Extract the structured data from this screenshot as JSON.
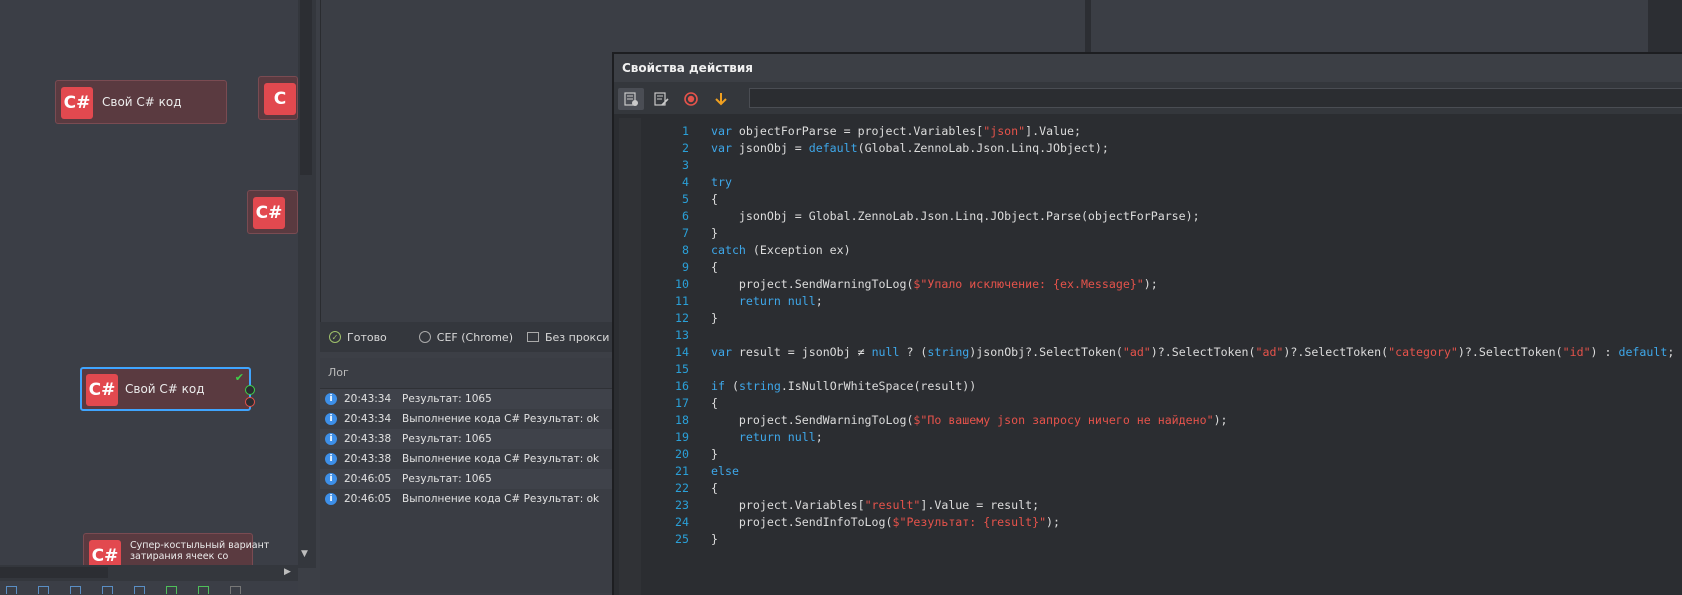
{
  "canvas": {
    "nodes": [
      {
        "badge": "C#",
        "label": "Свой C# код"
      },
      {
        "badge": "C#",
        "label": "Свой C# код"
      },
      {
        "badge": "C#",
        "label": "Супер-костыльный вариант затирания ячеек со"
      }
    ],
    "partial_badges": [
      "C",
      "C#"
    ]
  },
  "browser_status": {
    "ready": "Готово",
    "engine": "CEF (Chrome)",
    "proxy": "Без прокси"
  },
  "log": {
    "title": "Лог",
    "entries": [
      {
        "time": "20:43:34",
        "message": " Результат: 1065"
      },
      {
        "time": "20:43:34",
        "message": "Выполнение кода C#  Результат: ok"
      },
      {
        "time": "20:43:38",
        "message": " Результат: 1065"
      },
      {
        "time": "20:43:38",
        "message": "Выполнение кода C#  Результат: ok"
      },
      {
        "time": "20:46:05",
        "message": " Результат: 1065"
      },
      {
        "time": "20:46:05",
        "message": "Выполнение кода C#  Результат: ok"
      }
    ]
  },
  "dialog": {
    "title": "Свойства действия",
    "toolbar_icons": [
      "properties-icon",
      "edit-icon",
      "record-icon",
      "download-arrow-icon"
    ],
    "code_lines": [
      [
        {
          "t": "kw",
          "v": "var"
        },
        {
          "t": "tx",
          "v": " objectForParse = project.Variables["
        },
        {
          "t": "str",
          "v": "\"json\""
        },
        {
          "t": "tx",
          "v": "].Value;"
        }
      ],
      [
        {
          "t": "kw",
          "v": "var"
        },
        {
          "t": "tx",
          "v": " jsonObj = "
        },
        {
          "t": "kw",
          "v": "default"
        },
        {
          "t": "tx",
          "v": "(Global.ZennoLab.Json.Linq.JObject);"
        }
      ],
      [],
      [
        {
          "t": "kw",
          "v": "try"
        }
      ],
      [
        {
          "t": "tx",
          "v": "{"
        }
      ],
      [
        {
          "t": "tx",
          "v": "    jsonObj = Global.ZennoLab.Json.Linq.JObject.Parse(objectForParse);"
        }
      ],
      [
        {
          "t": "tx",
          "v": "}"
        }
      ],
      [
        {
          "t": "kw",
          "v": "catch"
        },
        {
          "t": "tx",
          "v": " (Exception ex)"
        }
      ],
      [
        {
          "t": "tx",
          "v": "{"
        }
      ],
      [
        {
          "t": "tx",
          "v": "    project.SendWarningToLog("
        },
        {
          "t": "str",
          "v": "$\"Упало исключение: {ex.Message}\""
        },
        {
          "t": "tx",
          "v": ");"
        }
      ],
      [
        {
          "t": "tx",
          "v": "    "
        },
        {
          "t": "kw",
          "v": "return"
        },
        {
          "t": "tx",
          "v": " "
        },
        {
          "t": "kw",
          "v": "null"
        },
        {
          "t": "tx",
          "v": ";"
        }
      ],
      [
        {
          "t": "tx",
          "v": "}"
        }
      ],
      [],
      [
        {
          "t": "kw",
          "v": "var"
        },
        {
          "t": "tx",
          "v": " result = jsonObj ≠ "
        },
        {
          "t": "kw",
          "v": "null"
        },
        {
          "t": "tx",
          "v": " ? ("
        },
        {
          "t": "kw",
          "v": "string"
        },
        {
          "t": "tx",
          "v": ")jsonObj?.SelectToken("
        },
        {
          "t": "str",
          "v": "\"ad\""
        },
        {
          "t": "tx",
          "v": ")?.SelectToken("
        },
        {
          "t": "str",
          "v": "\"ad\""
        },
        {
          "t": "tx",
          "v": ")?.SelectToken("
        },
        {
          "t": "str",
          "v": "\"category\""
        },
        {
          "t": "tx",
          "v": ")?.SelectToken("
        },
        {
          "t": "str",
          "v": "\"id\""
        },
        {
          "t": "tx",
          "v": ") : "
        },
        {
          "t": "kw",
          "v": "default"
        },
        {
          "t": "tx",
          "v": ";"
        }
      ],
      [],
      [
        {
          "t": "kw",
          "v": "if"
        },
        {
          "t": "tx",
          "v": " ("
        },
        {
          "t": "kw",
          "v": "string"
        },
        {
          "t": "tx",
          "v": ".IsNullOrWhiteSpace(result))"
        }
      ],
      [
        {
          "t": "tx",
          "v": "{"
        }
      ],
      [
        {
          "t": "tx",
          "v": "    project.SendWarningToLog("
        },
        {
          "t": "str",
          "v": "$\"По вашему json запросу ничего не найдено\""
        },
        {
          "t": "tx",
          "v": ");"
        }
      ],
      [
        {
          "t": "tx",
          "v": "    "
        },
        {
          "t": "kw",
          "v": "return"
        },
        {
          "t": "tx",
          "v": " "
        },
        {
          "t": "kw",
          "v": "null"
        },
        {
          "t": "tx",
          "v": ";"
        }
      ],
      [
        {
          "t": "tx",
          "v": "}"
        }
      ],
      [
        {
          "t": "kw",
          "v": "else"
        }
      ],
      [
        {
          "t": "tx",
          "v": "{"
        }
      ],
      [
        {
          "t": "tx",
          "v": "    project.Variables["
        },
        {
          "t": "str",
          "v": "\"result\""
        },
        {
          "t": "tx",
          "v": "].Value = result;"
        }
      ],
      [
        {
          "t": "tx",
          "v": "    project.SendInfoToLog("
        },
        {
          "t": "str",
          "v": "$\"Результат: {result}\""
        },
        {
          "t": "tx",
          "v": ");"
        }
      ],
      [
        {
          "t": "tx",
          "v": "}"
        }
      ]
    ]
  },
  "colors": {
    "keyword": "#3ea7e9",
    "string": "#e5534b",
    "line_number": "#2aa0d8",
    "badge": "#e2494f"
  }
}
